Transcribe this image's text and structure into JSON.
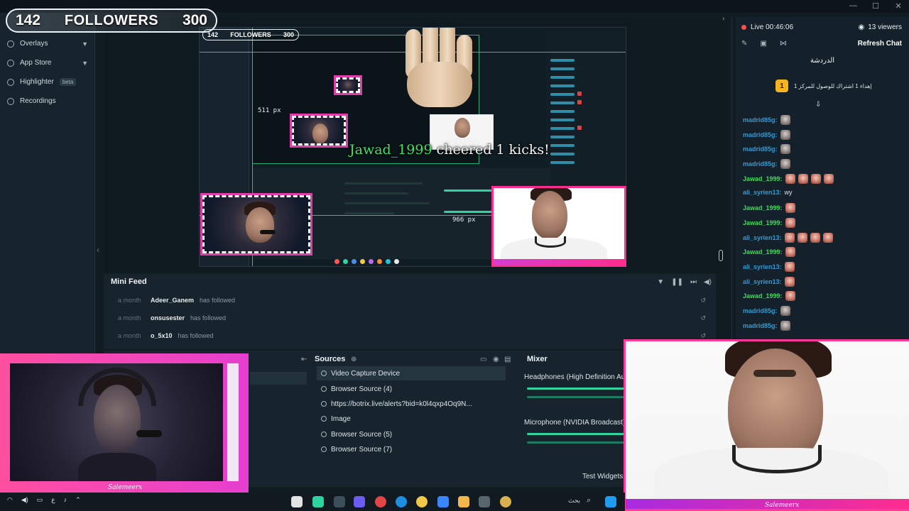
{
  "goal": {
    "current": "142",
    "label": "FOLLOWERS",
    "target": "300"
  },
  "sidebar": {
    "items": [
      {
        "label": "Overlays",
        "has_chevron": true
      },
      {
        "label": "App Store",
        "has_chevron": true
      },
      {
        "label": "Highlighter",
        "badge": "beta"
      },
      {
        "label": "Recordings"
      }
    ]
  },
  "preview": {
    "nested_goal": {
      "current": "142",
      "label": "FOLLOWERS",
      "target": "300"
    },
    "px_label_1": "511 px",
    "px_label_2": "966 px",
    "cheer": {
      "name": "Jawad_1999",
      "text": "cheered 1 kicks!"
    },
    "brand": "Salemeerx"
  },
  "minifeed": {
    "title": "Mini Feed",
    "rows": [
      {
        "time": "a month",
        "user": "Adeer_Ganem",
        "action": "has followed"
      },
      {
        "time": "a month",
        "user": "onsusester",
        "action": "has followed"
      },
      {
        "time": "a month",
        "user": "o_5x10",
        "action": "has followed"
      }
    ]
  },
  "docks": {
    "sources_title": "Sources",
    "sources": [
      {
        "label": "Video Capture Device",
        "selected": true
      },
      {
        "label": "Browser Source (4)"
      },
      {
        "label": "https://botrix.live/alerts?bid=k0l4qxp4Oq9N..."
      },
      {
        "label": "Image"
      },
      {
        "label": "Browser Source (5)"
      },
      {
        "label": "Browser Source (7)"
      }
    ],
    "mixer_title": "Mixer",
    "mixer": [
      {
        "label": "Headphones (High Definition Audi"
      },
      {
        "label": "Microphone (NVIDIA Broadcast)"
      }
    ],
    "test_widgets": "Test Widgets"
  },
  "chat": {
    "live_time": "Live 00:46:06",
    "viewers": "13 viewers",
    "refresh": "Refresh Chat",
    "title": "الدردشة",
    "pinned": "إهداء 1 اشتراك للوصول للمركز 1",
    "pinned_badge": "1",
    "messages": [
      {
        "user": "madrid85g:",
        "color": "#2f9bd6",
        "emotes": 1,
        "grey": true
      },
      {
        "user": "madrid85g:",
        "color": "#2f9bd6",
        "emotes": 1,
        "grey": true
      },
      {
        "user": "madrid85g:",
        "color": "#2f9bd6",
        "emotes": 1,
        "grey": true
      },
      {
        "user": "madrid85g:",
        "color": "#2f9bd6",
        "emotes": 1,
        "grey": true
      },
      {
        "user": "Jawad_1999:",
        "color": "#3ddc5a",
        "emotes": 4
      },
      {
        "user": "ali_syrien13:",
        "color": "#2f9bd6",
        "text": "wy"
      },
      {
        "user": "Jawad_1999:",
        "color": "#3ddc5a",
        "emotes": 1
      },
      {
        "user": "Jawad_1999:",
        "color": "#3ddc5a",
        "emotes": 1
      },
      {
        "user": "ali_syrien13:",
        "color": "#2f9bd6",
        "emotes": 4
      },
      {
        "user": "Jawad_1999:",
        "color": "#3ddc5a",
        "emotes": 1
      },
      {
        "user": "ali_syrien13:",
        "color": "#2f9bd6",
        "emotes": 1
      },
      {
        "user": "ali_syrien13:",
        "color": "#2f9bd6",
        "emotes": 1
      },
      {
        "user": "Jawad_1999:",
        "color": "#3ddc5a",
        "emotes": 1
      },
      {
        "user": "madrid85g:",
        "color": "#2f9bd6",
        "emotes": 1,
        "grey": true
      },
      {
        "user": "madrid85g:",
        "color": "#2f9bd6",
        "emotes": 1,
        "grey": true
      }
    ]
  },
  "cams": {
    "brand": "Salemeerx"
  },
  "taskbar": {
    "locale": "ع",
    "search": "بحث"
  },
  "colors": {
    "accent_pink": "#ff2d8e",
    "accent_green": "#2dd4a0",
    "live_red": "#ff4c4c"
  }
}
